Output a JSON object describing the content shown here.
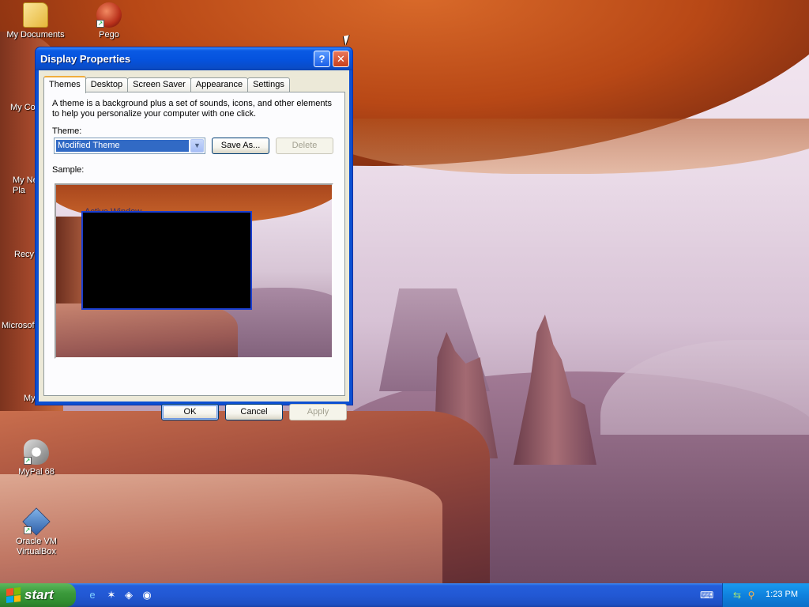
{
  "desktop": {
    "icons": [
      {
        "label": "My Documents",
        "icon": "folder-documents-icon"
      },
      {
        "label": "Pego",
        "icon": "pego-app-icon"
      },
      {
        "label": "My Co",
        "icon": "computer-icon"
      },
      {
        "label": "My Ne\nPla",
        "icon": "network-places-icon"
      },
      {
        "label": "Recy",
        "icon": "recycle-bin-icon"
      },
      {
        "label": "Microsof",
        "icon": "microsoft-app-icon"
      },
      {
        "label": "My",
        "icon": "shortcut-icon"
      },
      {
        "label": "MyPal 68",
        "icon": "mypal-browser-icon"
      },
      {
        "label": "Oracle VM\nVirtualBox",
        "icon": "virtualbox-icon"
      }
    ]
  },
  "window": {
    "title": "Display Properties",
    "help_glyph": "?",
    "close_glyph": "✕",
    "tabs": [
      {
        "label": "Themes",
        "active": true
      },
      {
        "label": "Desktop"
      },
      {
        "label": "Screen Saver"
      },
      {
        "label": "Appearance"
      },
      {
        "label": "Settings"
      }
    ],
    "description": "A theme is a background plus a set of sounds, icons, and other elements to help you personalize your computer with one click.",
    "theme_label": "Theme:",
    "theme_value": "Modified Theme",
    "save_as_label": "Save As...",
    "delete_label": "Delete",
    "sample_label": "Sample:",
    "sample_window_title": "Active Window",
    "ok_label": "OK",
    "cancel_label": "Cancel",
    "apply_label": "Apply"
  },
  "taskbar": {
    "start_label": "start",
    "quick_launch": [
      "internet-explorer-icon",
      "media-icon",
      "virtualbox-icon",
      "mypal-icon"
    ],
    "tray_icons": [
      "keyboard-icon",
      "network-icon",
      "search-icon"
    ],
    "clock": "1:23 PM"
  },
  "colors": {
    "titlebar_blue": "#0552dd",
    "dialog_face": "#ece9d8",
    "selection_blue": "#316ac5",
    "start_green": "#3c9a3c",
    "taskbar_blue": "#245edb"
  }
}
